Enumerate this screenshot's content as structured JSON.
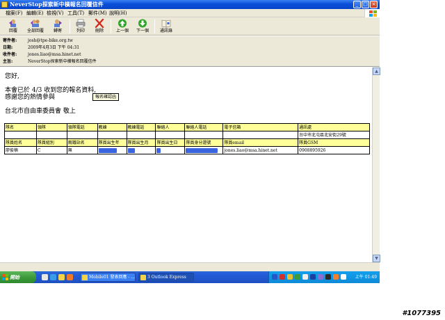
{
  "window": {
    "title": "NeverStop探索新中橫報名回覆信件"
  },
  "menu": [
    "檔案(F)",
    "編輯(E)",
    "檢視(V)",
    "工具(T)",
    "郵件(M)",
    "說明(H)"
  ],
  "toolbar": [
    {
      "name": "reply",
      "label": "回覆"
    },
    {
      "name": "reply-all",
      "label": "全部回覆"
    },
    {
      "name": "forward",
      "label": "轉寄"
    },
    {
      "name": "print",
      "label": "列印"
    },
    {
      "name": "delete",
      "label": "刪除"
    },
    {
      "name": "previous",
      "label": "上一個"
    },
    {
      "name": "next",
      "label": "下一個"
    },
    {
      "name": "address-book",
      "label": "通訊錄"
    }
  ],
  "headers": {
    "from_label": "寄件者:",
    "from_value": "josh@tpe-bike.org.tw",
    "date_label": "日期:",
    "date_value": "2009年4月3日 下午 04:31",
    "to_label": "收件者:",
    "to_value": "jones.liao@msa.hinet.net",
    "subject_label": "主旨:",
    "subject_value": "NeverStop探索新中橫報名回覆信件"
  },
  "body": {
    "greeting": "您好,",
    "line1": "本會已於 4/3 收到您的報名資料,",
    "line2": "感謝您的熱情參與",
    "signature": "台北市自由車委員會 敬上",
    "tooltip": "報名確認函"
  },
  "form_table": {
    "header1": [
      "隊名",
      "領隊",
      "領隊電話",
      "教練",
      "教練電話",
      "聯絡人",
      "聯絡人電話",
      "電子信箱",
      "通訊處"
    ],
    "row1": [
      "",
      "",
      "",
      "",
      "",
      "",
      "",
      "",
      "台中市北屯區北安街29號"
    ],
    "header2": [
      "隊員姓名",
      "隊員組別",
      "兩鐵站名",
      "隊員出生年",
      "隊員出生月",
      "隊員出生日",
      "隊員身分證號",
      "隊員email",
      "隊員GSM"
    ],
    "row2": [
      "廖俊楠",
      "C",
      "無",
      "",
      "",
      "",
      "",
      "jones.liao@msa.hinet.net",
      "0908895926"
    ]
  },
  "taskbar": {
    "start_label": "開始",
    "tasks": [
      "Mobile01 發表回應 - ...",
      "3 Outlook Express"
    ],
    "clock": "上午 01:49"
  },
  "watermark": "#1077395"
}
